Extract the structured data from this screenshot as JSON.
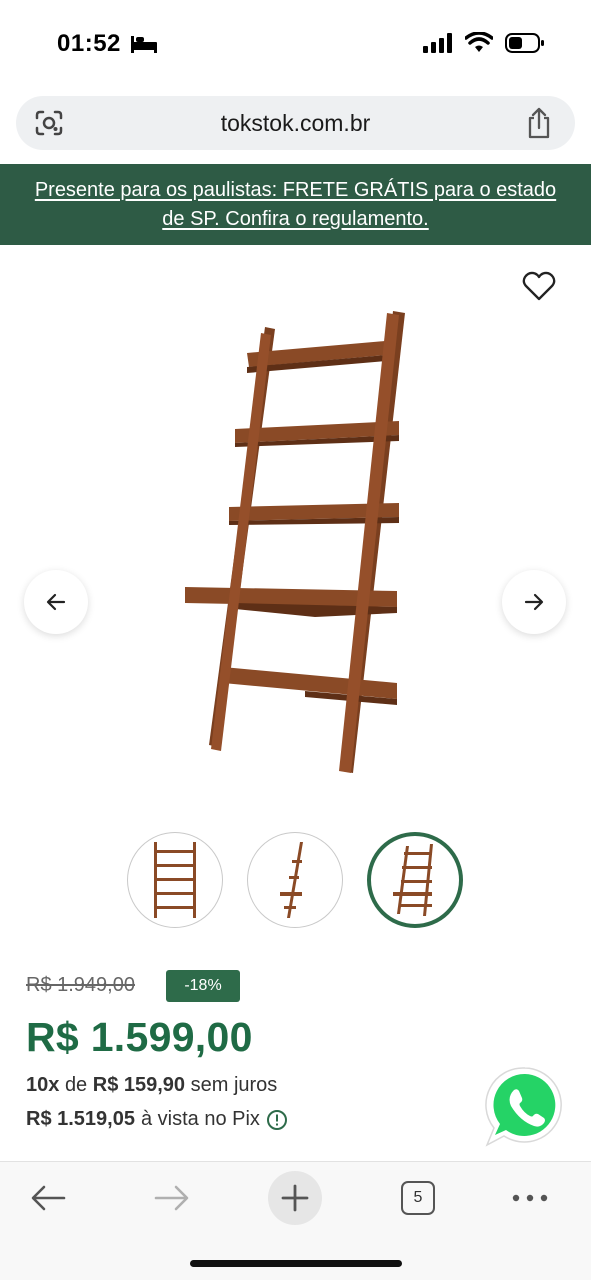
{
  "status_bar": {
    "time": "01:52"
  },
  "browser": {
    "url": "tokstok.com.br",
    "tab_count": "5"
  },
  "promo": {
    "text": "Presente para os paulistas: FRETE GRÁTIS para o estado de SP. Confira o regulamento."
  },
  "product": {
    "old_price": "R$ 1.949,00",
    "discount": "-18%",
    "price": "R$ 1.599,00",
    "installments": {
      "count": "10x",
      "de": "de",
      "value": "R$ 159,90",
      "suffix": "sem juros"
    },
    "pix": {
      "value": "R$ 1.519,05",
      "suffix": "à vista no Pix"
    },
    "thumbnails": [
      "front-view",
      "side-view",
      "angled-view"
    ],
    "selected_thumbnail": 3
  },
  "colors": {
    "brand_green": "#2e6b4a",
    "banner_green": "#2e5b45",
    "price_green": "#1f6b45",
    "whatsapp": "#25d366",
    "wood": "#8a4a26"
  }
}
